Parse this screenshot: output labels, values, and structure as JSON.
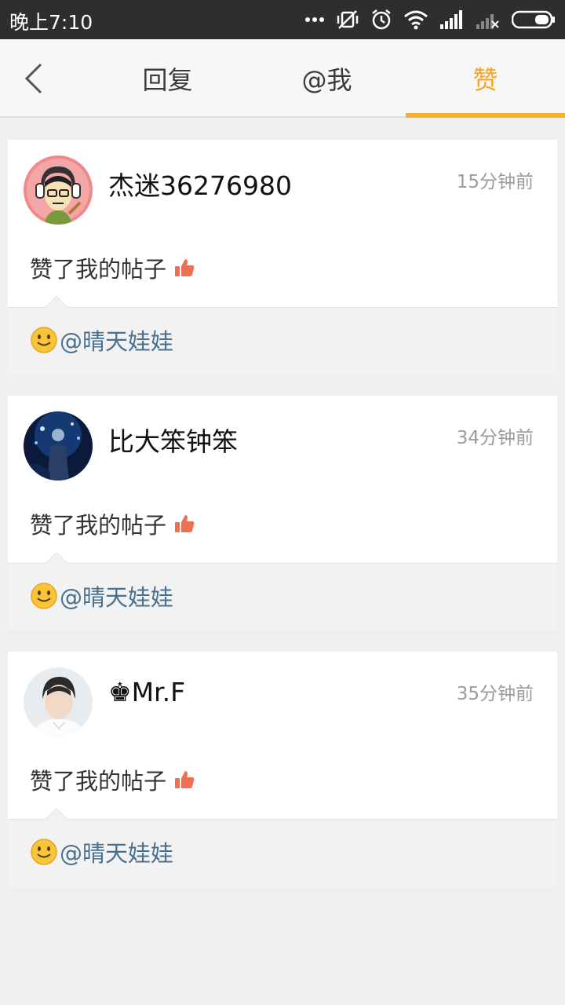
{
  "status_bar": {
    "time": "晚上7:10",
    "icons": [
      "more-dots-icon",
      "vibrate-off-icon",
      "alarm-icon",
      "wifi-icon",
      "signal-icon",
      "signal-no-sim-icon",
      "battery-icon"
    ]
  },
  "header": {
    "back_icon": "chevron-left-icon",
    "tabs": [
      {
        "label": "回复",
        "active": false
      },
      {
        "label": "@我",
        "active": false
      },
      {
        "label": "赞",
        "active": true
      }
    ],
    "accent_color": "#f6a623"
  },
  "notifications": [
    {
      "username": "杰迷36276980",
      "time": "15分钟前",
      "action": "赞了我的帖子",
      "mention": "@晴天娃娃"
    },
    {
      "username": "比大笨钟笨",
      "time": "34分钟前",
      "action": "赞了我的帖子",
      "mention": "@晴天娃娃"
    },
    {
      "username": "♚Mr.F",
      "time": "35分钟前",
      "action": "赞了我的帖子",
      "mention": "@晴天娃娃"
    }
  ]
}
